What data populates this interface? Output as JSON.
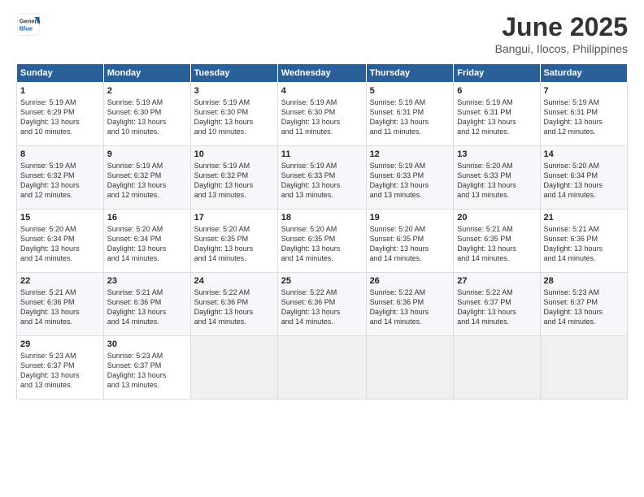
{
  "logo": {
    "general": "General",
    "blue": "Blue"
  },
  "title": {
    "month_year": "June 2025",
    "location": "Bangui, Ilocos, Philippines"
  },
  "weekdays": [
    "Sunday",
    "Monday",
    "Tuesday",
    "Wednesday",
    "Thursday",
    "Friday",
    "Saturday"
  ],
  "weeks": [
    [
      {
        "day": "1",
        "info": "Sunrise: 5:19 AM\nSunset: 6:29 PM\nDaylight: 13 hours\nand 10 minutes."
      },
      {
        "day": "2",
        "info": "Sunrise: 5:19 AM\nSunset: 6:30 PM\nDaylight: 13 hours\nand 10 minutes."
      },
      {
        "day": "3",
        "info": "Sunrise: 5:19 AM\nSunset: 6:30 PM\nDaylight: 13 hours\nand 10 minutes."
      },
      {
        "day": "4",
        "info": "Sunrise: 5:19 AM\nSunset: 6:30 PM\nDaylight: 13 hours\nand 11 minutes."
      },
      {
        "day": "5",
        "info": "Sunrise: 5:19 AM\nSunset: 6:31 PM\nDaylight: 13 hours\nand 11 minutes."
      },
      {
        "day": "6",
        "info": "Sunrise: 5:19 AM\nSunset: 6:31 PM\nDaylight: 13 hours\nand 12 minutes."
      },
      {
        "day": "7",
        "info": "Sunrise: 5:19 AM\nSunset: 6:31 PM\nDaylight: 13 hours\nand 12 minutes."
      }
    ],
    [
      {
        "day": "8",
        "info": "Sunrise: 5:19 AM\nSunset: 6:32 PM\nDaylight: 13 hours\nand 12 minutes."
      },
      {
        "day": "9",
        "info": "Sunrise: 5:19 AM\nSunset: 6:32 PM\nDaylight: 13 hours\nand 12 minutes."
      },
      {
        "day": "10",
        "info": "Sunrise: 5:19 AM\nSunset: 6:32 PM\nDaylight: 13 hours\nand 13 minutes."
      },
      {
        "day": "11",
        "info": "Sunrise: 5:19 AM\nSunset: 6:33 PM\nDaylight: 13 hours\nand 13 minutes."
      },
      {
        "day": "12",
        "info": "Sunrise: 5:19 AM\nSunset: 6:33 PM\nDaylight: 13 hours\nand 13 minutes."
      },
      {
        "day": "13",
        "info": "Sunrise: 5:20 AM\nSunset: 6:33 PM\nDaylight: 13 hours\nand 13 minutes."
      },
      {
        "day": "14",
        "info": "Sunrise: 5:20 AM\nSunset: 6:34 PM\nDaylight: 13 hours\nand 14 minutes."
      }
    ],
    [
      {
        "day": "15",
        "info": "Sunrise: 5:20 AM\nSunset: 6:34 PM\nDaylight: 13 hours\nand 14 minutes."
      },
      {
        "day": "16",
        "info": "Sunrise: 5:20 AM\nSunset: 6:34 PM\nDaylight: 13 hours\nand 14 minutes."
      },
      {
        "day": "17",
        "info": "Sunrise: 5:20 AM\nSunset: 6:35 PM\nDaylight: 13 hours\nand 14 minutes."
      },
      {
        "day": "18",
        "info": "Sunrise: 5:20 AM\nSunset: 6:35 PM\nDaylight: 13 hours\nand 14 minutes."
      },
      {
        "day": "19",
        "info": "Sunrise: 5:20 AM\nSunset: 6:35 PM\nDaylight: 13 hours\nand 14 minutes."
      },
      {
        "day": "20",
        "info": "Sunrise: 5:21 AM\nSunset: 6:35 PM\nDaylight: 13 hours\nand 14 minutes."
      },
      {
        "day": "21",
        "info": "Sunrise: 5:21 AM\nSunset: 6:36 PM\nDaylight: 13 hours\nand 14 minutes."
      }
    ],
    [
      {
        "day": "22",
        "info": "Sunrise: 5:21 AM\nSunset: 6:36 PM\nDaylight: 13 hours\nand 14 minutes."
      },
      {
        "day": "23",
        "info": "Sunrise: 5:21 AM\nSunset: 6:36 PM\nDaylight: 13 hours\nand 14 minutes."
      },
      {
        "day": "24",
        "info": "Sunrise: 5:22 AM\nSunset: 6:36 PM\nDaylight: 13 hours\nand 14 minutes."
      },
      {
        "day": "25",
        "info": "Sunrise: 5:22 AM\nSunset: 6:36 PM\nDaylight: 13 hours\nand 14 minutes."
      },
      {
        "day": "26",
        "info": "Sunrise: 5:22 AM\nSunset: 6:36 PM\nDaylight: 13 hours\nand 14 minutes."
      },
      {
        "day": "27",
        "info": "Sunrise: 5:22 AM\nSunset: 6:37 PM\nDaylight: 13 hours\nand 14 minutes."
      },
      {
        "day": "28",
        "info": "Sunrise: 5:23 AM\nSunset: 6:37 PM\nDaylight: 13 hours\nand 14 minutes."
      }
    ],
    [
      {
        "day": "29",
        "info": "Sunrise: 5:23 AM\nSunset: 6:37 PM\nDaylight: 13 hours\nand 13 minutes."
      },
      {
        "day": "30",
        "info": "Sunrise: 5:23 AM\nSunset: 6:37 PM\nDaylight: 13 hours\nand 13 minutes."
      },
      {
        "day": "",
        "info": ""
      },
      {
        "day": "",
        "info": ""
      },
      {
        "day": "",
        "info": ""
      },
      {
        "day": "",
        "info": ""
      },
      {
        "day": "",
        "info": ""
      }
    ]
  ]
}
